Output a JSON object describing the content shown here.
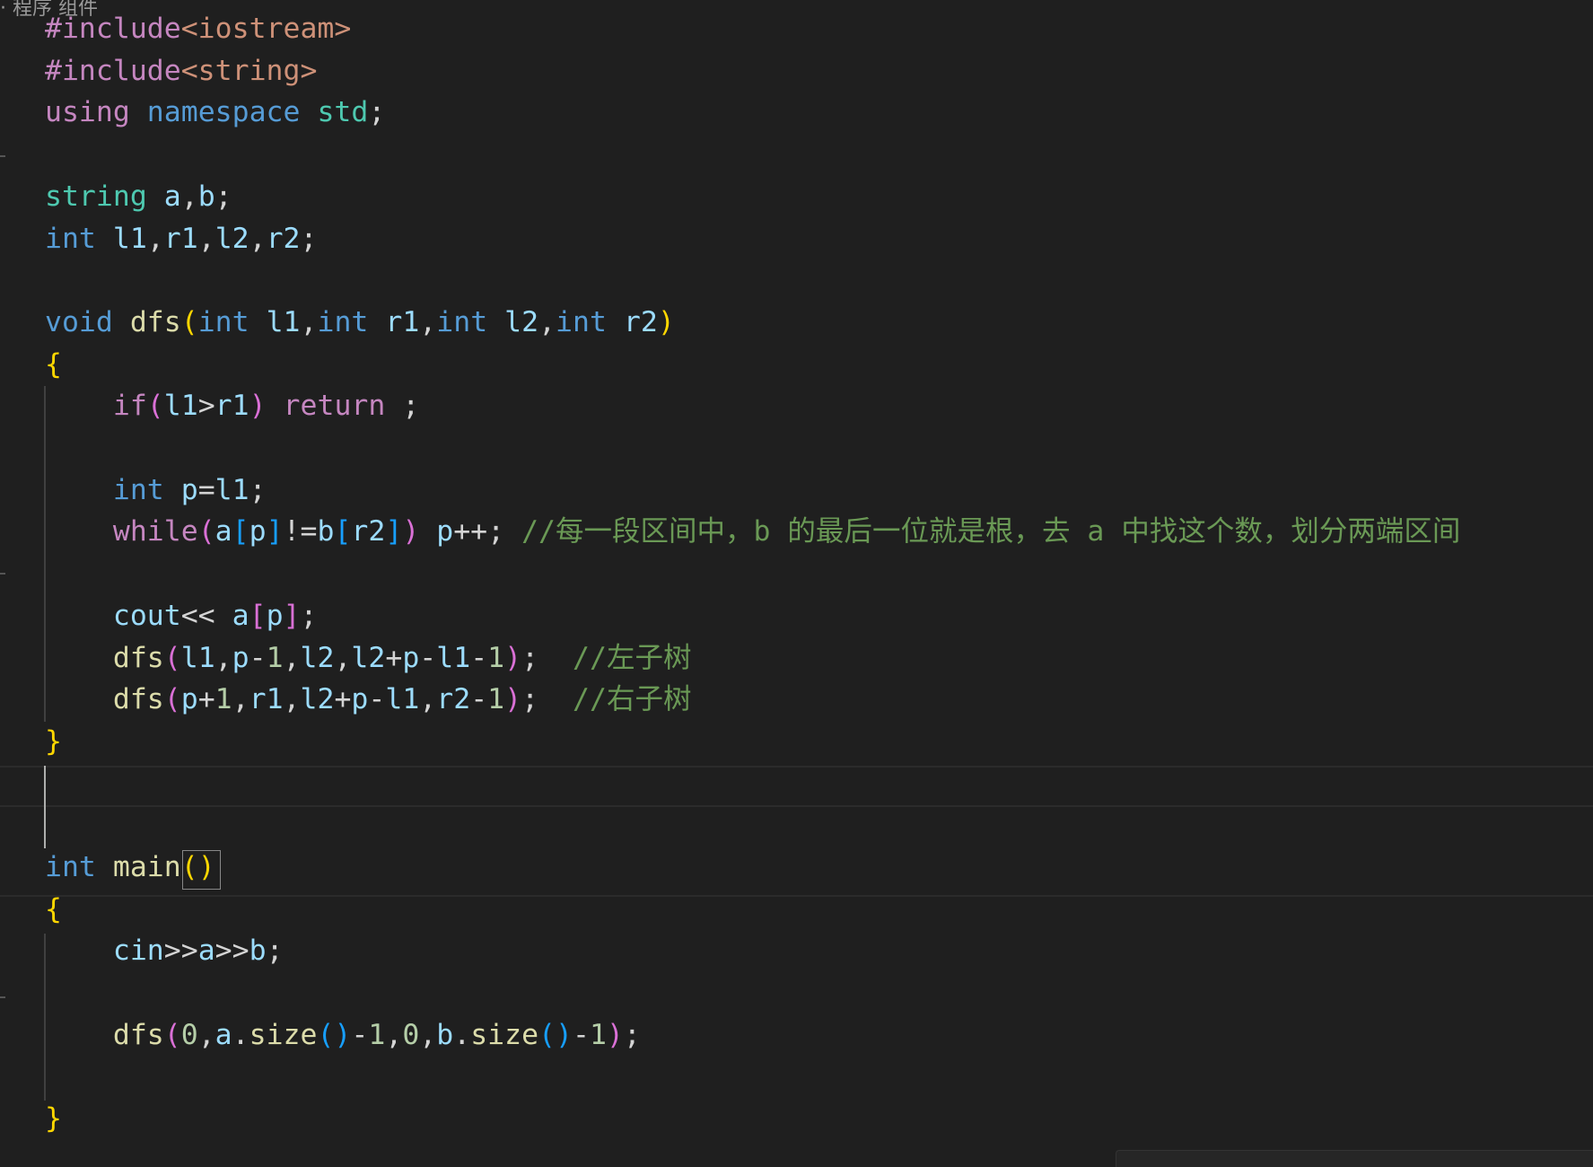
{
  "top_fragment": "· 程序 组件",
  "lines": [
    [
      [
        "t-pre",
        "#include"
      ],
      [
        "t-inc",
        "<iostream>"
      ]
    ],
    [
      [
        "t-pre",
        "#include"
      ],
      [
        "t-inc",
        "<string>"
      ]
    ],
    [
      [
        "t-ctl",
        "using"
      ],
      [
        "t-p",
        " "
      ],
      [
        "t-kw",
        "namespace"
      ],
      [
        "t-p",
        " "
      ],
      [
        "t-type",
        "std"
      ],
      [
        "t-p",
        ";"
      ]
    ],
    [],
    [
      [
        "t-type",
        "string"
      ],
      [
        "t-p",
        " "
      ],
      [
        "t-var",
        "a"
      ],
      [
        "t-p",
        ","
      ],
      [
        "t-var",
        "b"
      ],
      [
        "t-p",
        ";"
      ]
    ],
    [
      [
        "t-kw",
        "int"
      ],
      [
        "t-p",
        " "
      ],
      [
        "t-var",
        "l1"
      ],
      [
        "t-p",
        ","
      ],
      [
        "t-var",
        "r1"
      ],
      [
        "t-p",
        ","
      ],
      [
        "t-var",
        "l2"
      ],
      [
        "t-p",
        ","
      ],
      [
        "t-var",
        "r2"
      ],
      [
        "t-p",
        ";"
      ]
    ],
    [],
    [
      [
        "t-kw",
        "void"
      ],
      [
        "t-p",
        " "
      ],
      [
        "t-fn",
        "dfs"
      ],
      [
        "t-b1",
        "("
      ],
      [
        "t-kw",
        "int"
      ],
      [
        "t-p",
        " "
      ],
      [
        "t-var",
        "l1"
      ],
      [
        "t-p",
        ","
      ],
      [
        "t-kw",
        "int"
      ],
      [
        "t-p",
        " "
      ],
      [
        "t-var",
        "r1"
      ],
      [
        "t-p",
        ","
      ],
      [
        "t-kw",
        "int"
      ],
      [
        "t-p",
        " "
      ],
      [
        "t-var",
        "l2"
      ],
      [
        "t-p",
        ","
      ],
      [
        "t-kw",
        "int"
      ],
      [
        "t-p",
        " "
      ],
      [
        "t-var",
        "r2"
      ],
      [
        "t-b1",
        ")"
      ]
    ],
    [
      [
        "t-b1",
        "{"
      ]
    ],
    [
      [
        "t-p",
        "    "
      ],
      [
        "t-ctl",
        "if"
      ],
      [
        "t-b2",
        "("
      ],
      [
        "t-var",
        "l1"
      ],
      [
        "t-p",
        ">"
      ],
      [
        "t-var",
        "r1"
      ],
      [
        "t-b2",
        ")"
      ],
      [
        "t-p",
        " "
      ],
      [
        "t-ctl",
        "return"
      ],
      [
        "t-p",
        " ;"
      ]
    ],
    [],
    [
      [
        "t-p",
        "    "
      ],
      [
        "t-kw",
        "int"
      ],
      [
        "t-p",
        " "
      ],
      [
        "t-var",
        "p"
      ],
      [
        "t-p",
        "="
      ],
      [
        "t-var",
        "l1"
      ],
      [
        "t-p",
        ";"
      ]
    ],
    [
      [
        "t-p",
        "    "
      ],
      [
        "t-ctl",
        "while"
      ],
      [
        "t-b2",
        "("
      ],
      [
        "t-var",
        "a"
      ],
      [
        "t-b3",
        "["
      ],
      [
        "t-var",
        "p"
      ],
      [
        "t-b3",
        "]"
      ],
      [
        "t-p",
        "!="
      ],
      [
        "t-var",
        "b"
      ],
      [
        "t-b3",
        "["
      ],
      [
        "t-var",
        "r2"
      ],
      [
        "t-b3",
        "]"
      ],
      [
        "t-b2",
        ")"
      ],
      [
        "t-p",
        " "
      ],
      [
        "t-var",
        "p"
      ],
      [
        "t-p",
        "++; "
      ],
      [
        "t-com",
        "//每一段区间中，b 的最后一位就是根，去 a 中找这个数，划分两端区间"
      ]
    ],
    [],
    [
      [
        "t-p",
        "    "
      ],
      [
        "t-var",
        "cout"
      ],
      [
        "t-p",
        "<< "
      ],
      [
        "t-var",
        "a"
      ],
      [
        "t-b2",
        "["
      ],
      [
        "t-var",
        "p"
      ],
      [
        "t-b2",
        "]"
      ],
      [
        "t-p",
        ";"
      ]
    ],
    [
      [
        "t-p",
        "    "
      ],
      [
        "t-fn",
        "dfs"
      ],
      [
        "t-b2",
        "("
      ],
      [
        "t-var",
        "l1"
      ],
      [
        "t-p",
        ","
      ],
      [
        "t-var",
        "p"
      ],
      [
        "t-p",
        "-"
      ],
      [
        "t-num",
        "1"
      ],
      [
        "t-p",
        ","
      ],
      [
        "t-var",
        "l2"
      ],
      [
        "t-p",
        ","
      ],
      [
        "t-var",
        "l2"
      ],
      [
        "t-p",
        "+"
      ],
      [
        "t-var",
        "p"
      ],
      [
        "t-p",
        "-"
      ],
      [
        "t-var",
        "l1"
      ],
      [
        "t-p",
        "-"
      ],
      [
        "t-num",
        "1"
      ],
      [
        "t-b2",
        ")"
      ],
      [
        "t-p",
        ";  "
      ],
      [
        "t-com",
        "//左子树"
      ]
    ],
    [
      [
        "t-p",
        "    "
      ],
      [
        "t-fn",
        "dfs"
      ],
      [
        "t-b2",
        "("
      ],
      [
        "t-var",
        "p"
      ],
      [
        "t-p",
        "+"
      ],
      [
        "t-num",
        "1"
      ],
      [
        "t-p",
        ","
      ],
      [
        "t-var",
        "r1"
      ],
      [
        "t-p",
        ","
      ],
      [
        "t-var",
        "l2"
      ],
      [
        "t-p",
        "+"
      ],
      [
        "t-var",
        "p"
      ],
      [
        "t-p",
        "-"
      ],
      [
        "t-var",
        "l1"
      ],
      [
        "t-p",
        ","
      ],
      [
        "t-var",
        "r2"
      ],
      [
        "t-p",
        "-"
      ],
      [
        "t-num",
        "1"
      ],
      [
        "t-b2",
        ")"
      ],
      [
        "t-p",
        ";  "
      ],
      [
        "t-com",
        "//右子树"
      ]
    ],
    [
      [
        "t-b1",
        "}"
      ]
    ],
    [],
    [],
    [
      [
        "t-kw",
        "int"
      ],
      [
        "t-p",
        " "
      ],
      [
        "t-fn",
        "main"
      ],
      [
        "t-b1",
        "()"
      ]
    ],
    [
      [
        "t-b1",
        "{"
      ]
    ],
    [
      [
        "t-p",
        "    "
      ],
      [
        "t-var",
        "cin"
      ],
      [
        "t-p",
        ">>"
      ],
      [
        "t-var",
        "a"
      ],
      [
        "t-p",
        ">>"
      ],
      [
        "t-var",
        "b"
      ],
      [
        "t-p",
        ";"
      ]
    ],
    [],
    [
      [
        "t-p",
        "    "
      ],
      [
        "t-fn",
        "dfs"
      ],
      [
        "t-b2",
        "("
      ],
      [
        "t-num",
        "0"
      ],
      [
        "t-p",
        ","
      ],
      [
        "t-var",
        "a"
      ],
      [
        "t-p",
        "."
      ],
      [
        "t-fn",
        "size"
      ],
      [
        "t-b3",
        "()"
      ],
      [
        "t-p",
        "-"
      ],
      [
        "t-num",
        "1"
      ],
      [
        "t-p",
        ","
      ],
      [
        "t-num",
        "0"
      ],
      [
        "t-p",
        ","
      ],
      [
        "t-var",
        "b"
      ],
      [
        "t-p",
        "."
      ],
      [
        "t-fn",
        "size"
      ],
      [
        "t-b3",
        "()"
      ],
      [
        "t-p",
        "-"
      ],
      [
        "t-num",
        "1"
      ],
      [
        "t-b2",
        ")"
      ],
      [
        "t-p",
        ";"
      ]
    ],
    [],
    [
      [
        "t-b1",
        "}"
      ]
    ]
  ]
}
